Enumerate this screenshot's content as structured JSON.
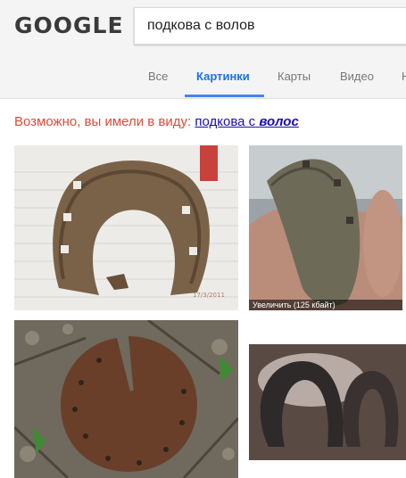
{
  "header": {
    "logo_text": "GOOGLE",
    "search_value": "подкова с волов"
  },
  "tabs": [
    {
      "label": "Все",
      "active": false
    },
    {
      "label": "Картинки",
      "active": true
    },
    {
      "label": "Карты",
      "active": false
    },
    {
      "label": "Видео",
      "active": false
    },
    {
      "label": "Н",
      "active": false
    }
  ],
  "suggestion": {
    "prefix": "Возможно, вы имели в виду:",
    "link_plain": "подкова с",
    "link_bold": "волос"
  },
  "results": [
    {
      "alt": "horseshoe-on-notebook",
      "date_stamp": "17/3/2011"
    },
    {
      "alt": "half-horseshoe-in-hand",
      "caption": "Увеличить (125 кбайт)"
    },
    {
      "alt": "rusty-disk-horseshoe-on-ground"
    },
    {
      "alt": "two-horseshoes-on-table"
    }
  ],
  "colors": {
    "accent": "#4285f4",
    "suggest_red": "#dd4b39",
    "link_blue": "#1a0dab"
  }
}
